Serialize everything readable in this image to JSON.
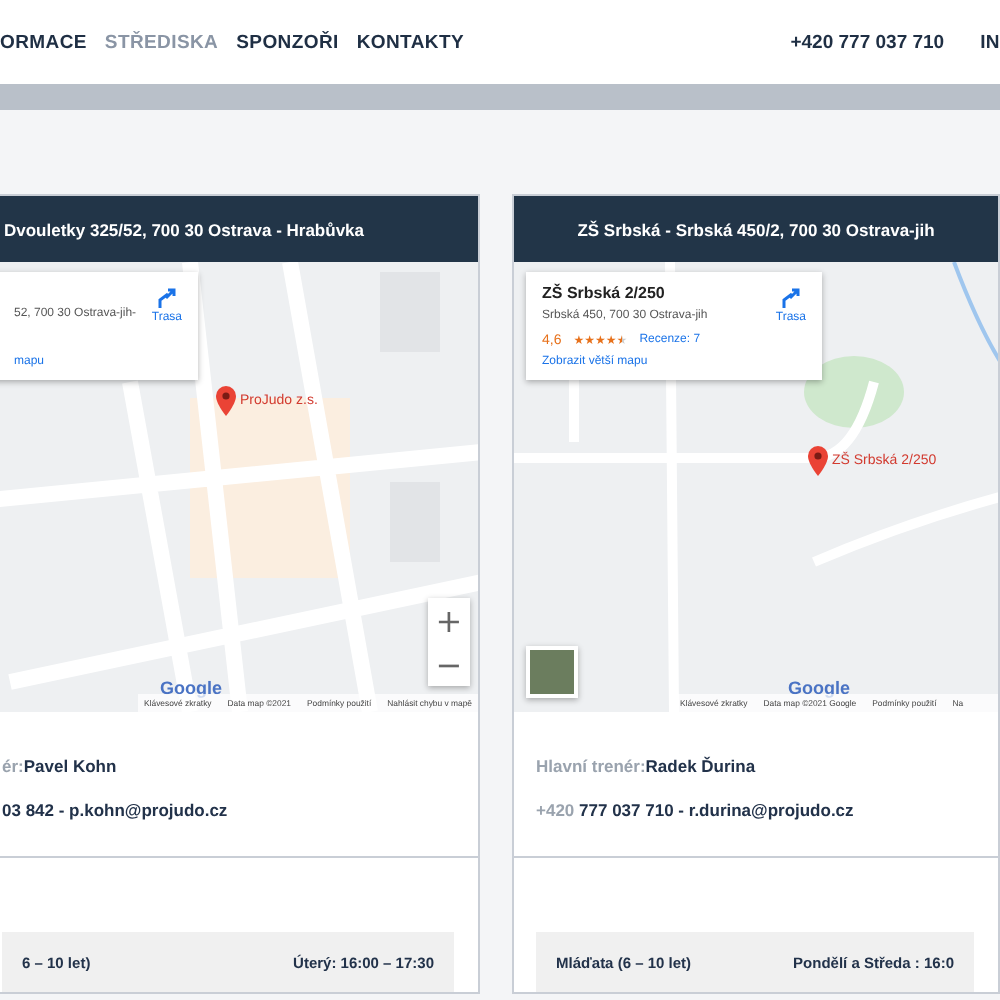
{
  "nav": {
    "items": [
      {
        "label": "ORMACE",
        "selected": false
      },
      {
        "label": "STŘEDISKA",
        "selected": true
      },
      {
        "label": "SPONZOŘI",
        "selected": false
      },
      {
        "label": "KONTAKTY",
        "selected": false
      }
    ],
    "phone": "+420 777 037 710",
    "cut_item": "IN"
  },
  "centers": [
    {
      "address": "Dvouletky 325/52, 700 30 Ostrava - Hrabůvka",
      "map": {
        "kind": "streets",
        "info_card": {
          "address": "52, 700 30 Ostrava-jih-",
          "link": "mapu",
          "directions": "Trasa"
        },
        "marker_label": "ProJudo z.s.",
        "zoom_in": "+",
        "zoom_out": "−",
        "logo": "Google",
        "attribution": [
          "Klávesové zkratky",
          "Data map ©2021",
          "Podmínky použití",
          "Nahlásit chybu v mapě"
        ]
      },
      "coach_label": "ér:",
      "coach_name": "Pavel Kohn",
      "contact": "03 842 - p.kohn@projudo.cz",
      "schedule": [
        {
          "group": "6 – 10 let)",
          "time": "Úterý: 16:00 – 17:30"
        }
      ]
    },
    {
      "address": "ZŠ Srbská - Srbská 450/2, 700 30 Ostrava-jih",
      "map": {
        "kind": "suburb",
        "info_card": {
          "title": "ZŠ Srbská 2/250",
          "address": "Srbská 450, 700 30 Ostrava-jih",
          "rating": "4,6",
          "stars": 4.5,
          "reviews": "Recenze: 7",
          "link": "Zobrazit větší mapu",
          "directions": "Trasa"
        },
        "marker_label": "ZŠ Srbská 2/250",
        "logo": "Google",
        "attribution": [
          "Klávesové zkratky",
          "Data map ©2021 Google",
          "Podmínky použití",
          "Na"
        ]
      },
      "coach_label": "Hlavní trenér:",
      "coach_name": "Radek Ďurina",
      "phone_prefix": "+420",
      "contact": "777 037 710 - r.durina@projudo.cz",
      "schedule": [
        {
          "group": "Mláďata (6 – 10 let)",
          "time": "Pondělí a Středa : 16:0"
        }
      ]
    }
  ]
}
